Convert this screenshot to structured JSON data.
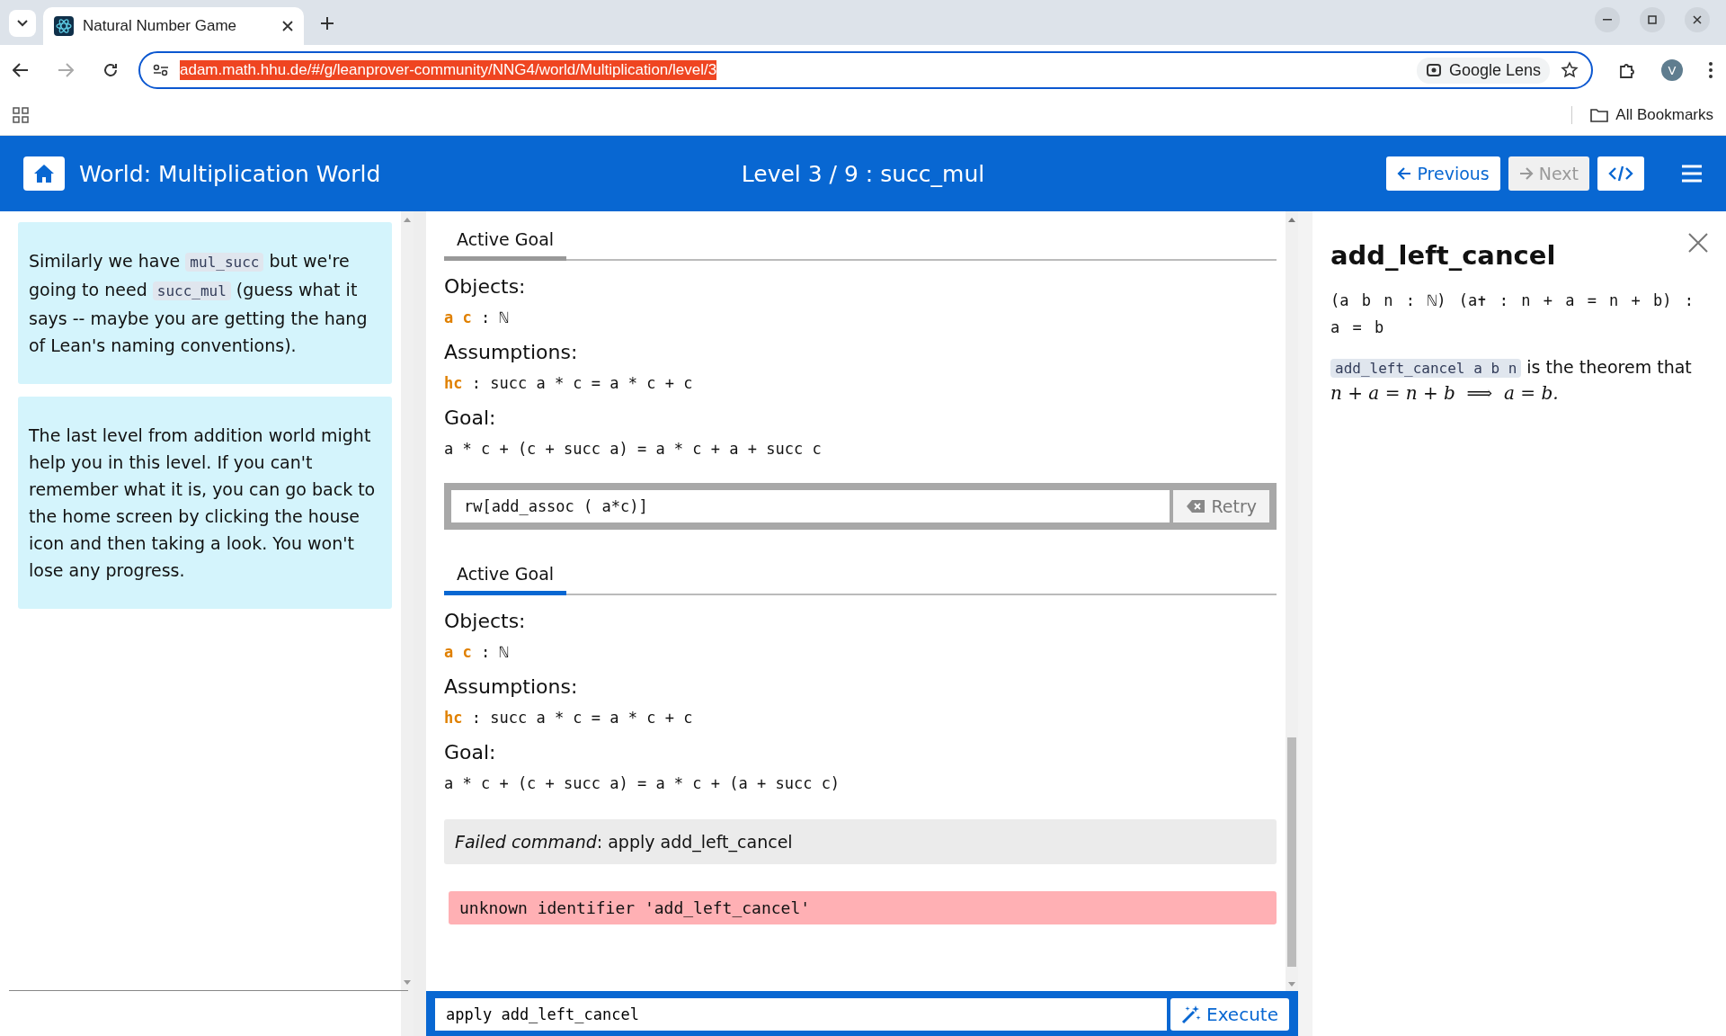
{
  "browser": {
    "tab_title": "Natural Number Game",
    "url": "adam.math.hhu.de/#/g/leanprover-community/NNG4/world/Multiplication/level/3",
    "lens_label": "Google Lens",
    "profile": "V",
    "bookmarks_label": "All Bookmarks"
  },
  "header": {
    "world": "World: Multiplication World",
    "level": "Level 3 / 9 : succ_mul",
    "previous": {
      "label": "Previous",
      "disabled": false
    },
    "next": {
      "label": "Next",
      "disabled": true
    }
  },
  "hints": [
    {
      "segments": [
        {
          "kind": "text",
          "text": "Similarly we have "
        },
        {
          "kind": "code",
          "text": "mul_succ"
        },
        {
          "kind": "text",
          "text": " but we're going to need "
        },
        {
          "kind": "code",
          "text": "succ_mul"
        },
        {
          "kind": "text",
          "text": " (guess what it says -- maybe you are getting the hang of Lean's naming conventions)."
        }
      ]
    },
    {
      "segments": [
        {
          "kind": "text",
          "text": "The last level from addition world might help you in this level. If you can't remember what it is, you can go back to the home screen by clicking the house icon and then taking a look. You won't lose any progress."
        }
      ]
    }
  ],
  "steps": [
    {
      "tab": {
        "label": "Active Goal",
        "selected": false
      },
      "objects_label": "Objects:",
      "objects": [
        {
          "names": "a c",
          "sep": ":",
          "type": "ℕ"
        }
      ],
      "assumptions_label": "Assumptions:",
      "assumptions": [
        {
          "name": "hc",
          "sep": ":",
          "type": "succ a * c = a * c + c"
        }
      ],
      "goal_label": "Goal:",
      "goal": "a * c + (c + succ a) = a * c + a + succ c",
      "command": "rw[add_assoc ( a*c)]",
      "retry_label": "Retry"
    },
    {
      "tab": {
        "label": "Active Goal",
        "selected": true
      },
      "objects_label": "Objects:",
      "objects": [
        {
          "names": "a c",
          "sep": ":",
          "type": "ℕ"
        }
      ],
      "assumptions_label": "Assumptions:",
      "assumptions": [
        {
          "name": "hc",
          "sep": ":",
          "type": "succ a * c = a * c + c"
        }
      ],
      "goal_label": "Goal:",
      "goal": "a * c + (c + succ a) = a * c + (a + succ c)"
    }
  ],
  "failed": {
    "label": "Failed command",
    "text": ": apply add_left_cancel"
  },
  "error": "unknown identifier 'add_left_cancel'",
  "input": {
    "value": "apply add_left_cancel",
    "execute_label": "Execute"
  },
  "doc": {
    "title": "add_left_cancel",
    "signature": "(a b n : ℕ) (a✝ : n + a = n + b) : a = b",
    "code": "add_left_cancel a b n",
    "description": " is the theorem that",
    "math": "n + a = n + b  ⟹  a = b."
  }
}
